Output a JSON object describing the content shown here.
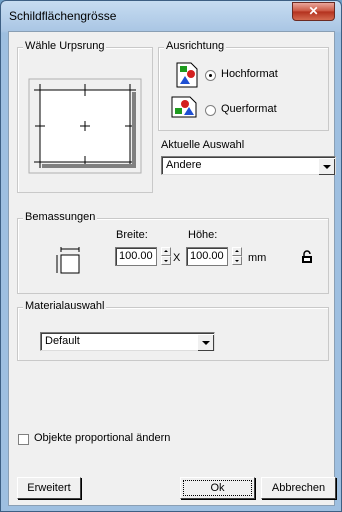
{
  "window": {
    "title": "Schildflächengrösse",
    "close_glyph": "✕"
  },
  "origin": {
    "title": "Wähle Urpsrung"
  },
  "orientation": {
    "title": "Ausrichtung",
    "portrait_label": "Hochformat",
    "landscape_label": "Querformat",
    "selected": "portrait"
  },
  "current_selection": {
    "label": "Aktuelle Auswahl",
    "value": "Andere"
  },
  "dimensions": {
    "title": "Bemassungen",
    "width_label": "Breite:",
    "height_label": "Höhe:",
    "width_value": "100.00",
    "height_value": "100.00",
    "times": "X",
    "unit": "mm"
  },
  "material": {
    "title": "Materialauswahl",
    "value": "Default"
  },
  "proportional": {
    "label": "Objekte proportional ändern",
    "checked": false
  },
  "buttons": {
    "advanced": "Erweitert",
    "ok": "Ok",
    "cancel": "Abbrechen"
  }
}
